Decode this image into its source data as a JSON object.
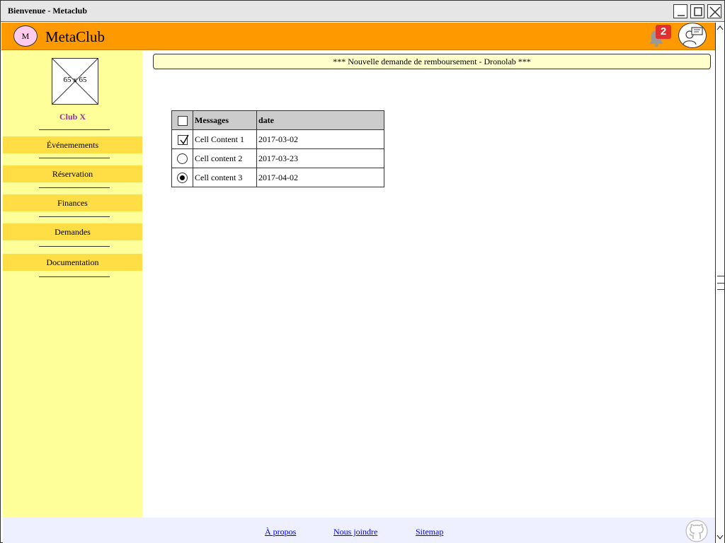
{
  "window": {
    "title": "Bienvenue - Metaclub"
  },
  "header": {
    "logo_letter": "M",
    "brand": "MetaClub",
    "notification_count": "2"
  },
  "sidebar": {
    "image_placeholder": "65 x 65",
    "club_name": "Club X",
    "items": [
      {
        "label": "Événemements"
      },
      {
        "label": "Réservation"
      },
      {
        "label": "Finances"
      },
      {
        "label": "Demandes"
      },
      {
        "label": "Documentation"
      }
    ]
  },
  "banner": {
    "text": "*** Nouvelle demande de remboursement - Dronolab ***"
  },
  "table": {
    "headers": [
      "Messages",
      "date"
    ],
    "rows": [
      {
        "message": "Cell Content 1",
        "date": "2017-03-02",
        "control": "checkbox-checked"
      },
      {
        "message": "Cell content 2",
        "date": "2017-03-23",
        "control": "radio-empty"
      },
      {
        "message": "Cell content 3",
        "date": "2017-04-02",
        "control": "radio-selected"
      }
    ]
  },
  "footer": {
    "links": [
      {
        "label": "À propos"
      },
      {
        "label": "Nous joindre"
      },
      {
        "label": "Sitemap"
      }
    ]
  },
  "colors": {
    "header": "#ff9900",
    "sidebar": "#ffff99",
    "nav_item": "#ffdd44",
    "club_name": "#993399",
    "banner": "#ffffcc",
    "footer": "#eef0ff",
    "badge": "#e03030"
  }
}
